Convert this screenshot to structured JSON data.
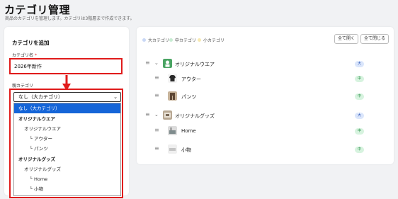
{
  "page": {
    "title": "カテゴリ管理",
    "subtitle": "商品のカテゴリを管理します。カテゴリは3階層まで作成できます。"
  },
  "add_form": {
    "title": "カテゴリを追加",
    "name_label": "カテゴリ名",
    "required_mark": "*",
    "name_value": "2026年新作",
    "parent_label": "親カテゴリ",
    "parent_selected": "なし（大カテゴリ）",
    "options": [
      {
        "label": "なし（大カテゴリ）",
        "selected": true
      },
      {
        "label": "オリジナルウエア",
        "group": true
      },
      {
        "label": "オリジナルウエア"
      },
      {
        "label": "└ アウター"
      },
      {
        "label": "└ パンツ"
      },
      {
        "label": "オリジナルグッズ",
        "group": true
      },
      {
        "label": "オリジナルグッズ"
      },
      {
        "label": "└ Home"
      },
      {
        "label": "└ 小物"
      }
    ]
  },
  "tree": {
    "legend": [
      {
        "label": "大カテゴリ",
        "color": "#c9d8f5"
      },
      {
        "label": "中カテゴリ",
        "color": "#c7ecd2"
      },
      {
        "label": "小カテゴリ",
        "color": "#f7e9b0"
      }
    ],
    "expand_all": "全て開く",
    "collapse_all": "全て閉じる",
    "rows": [
      {
        "label": "オリジナルウエア",
        "badge": "大",
        "level": 1,
        "thumb_color": "#4aa463"
      },
      {
        "label": "アウター",
        "badge": "中",
        "level": 2,
        "thumb_color": "#2a2a2a"
      },
      {
        "label": "パンツ",
        "badge": "中",
        "level": 2,
        "thumb_color": "#8b6a4f"
      },
      {
        "label": "オリジナルグッズ",
        "badge": "大",
        "level": 1,
        "thumb_color": "#a99883"
      },
      {
        "label": "Home",
        "badge": "中",
        "level": 2,
        "thumb_color": "#7f8c8d"
      },
      {
        "label": "小物",
        "badge": "中",
        "level": 2,
        "thumb_color": "#d6d6d6"
      }
    ]
  },
  "colors": {
    "highlight": "#e01b1b",
    "selected_option": "#1565d8"
  }
}
